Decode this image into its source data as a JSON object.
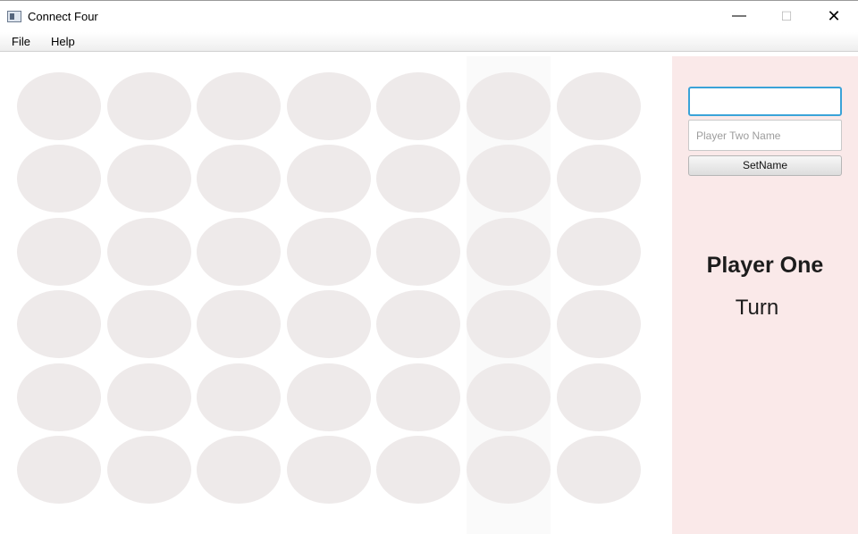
{
  "window": {
    "title": "Connect Four",
    "controls": {
      "minimize": "—",
      "maximize": "☐",
      "close": "✕"
    }
  },
  "menu": [
    "File",
    "Help"
  ],
  "board": {
    "columns": 7,
    "rows": 6,
    "highlighted_column": 6,
    "cell_color": "#eeeaea"
  },
  "sidebar": {
    "player_one_input_value": "",
    "player_two_placeholder": "Player Two Name",
    "set_name_label": "SetName",
    "current_player": "Player One",
    "turn_label": "Turn",
    "background": "#fae9e9"
  }
}
